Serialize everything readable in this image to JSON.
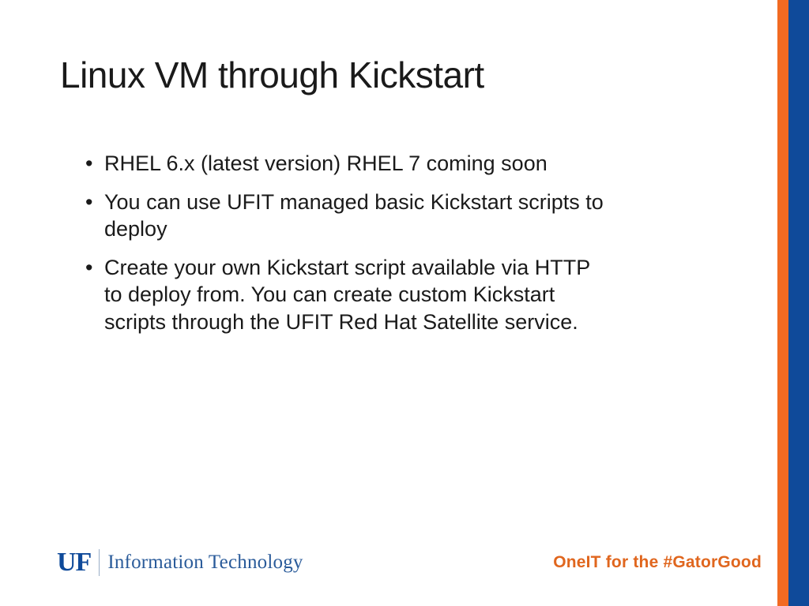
{
  "title": "Linux VM through Kickstart",
  "bullets": [
    "RHEL 6.x (latest version) RHEL 7 coming soon",
    "You can use UFIT managed basic Kickstart scripts to deploy",
    "Create your own Kickstart script available via HTTP to deploy from. You can create custom Kickstart scripts through the UFIT Red Hat Satellite service."
  ],
  "footer": {
    "uf_mark": "UF",
    "logo_text": "Information Technology",
    "tagline": "OneIT for the #GatorGood"
  },
  "colors": {
    "orange": "#f26a22",
    "blue": "#0f4a9a",
    "tagline_orange": "#e0661e",
    "text": "#1a1a1a"
  }
}
